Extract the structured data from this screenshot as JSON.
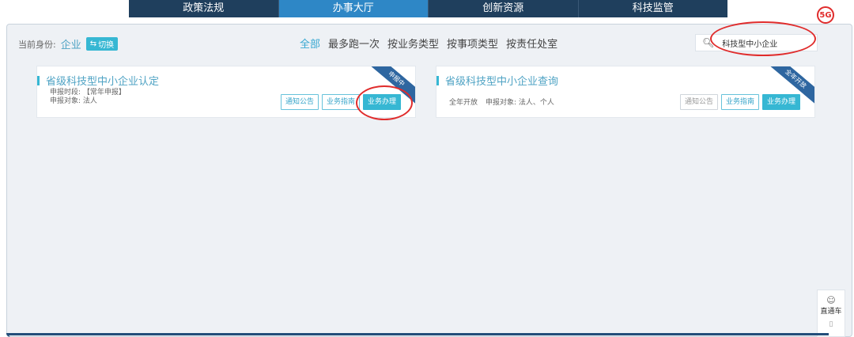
{
  "nav": {
    "tabs": [
      "政策法规",
      "办事大厅",
      "创新资源",
      "科技监管"
    ]
  },
  "identity": {
    "label": "当前身份:",
    "entity": "企业",
    "switch_label": "切换"
  },
  "filters": [
    "全部",
    "最多跑一次",
    "按业务类型",
    "按事项类型",
    "按责任处室"
  ],
  "search": {
    "value": "科技型中小企业"
  },
  "user_logo": "5G",
  "cards": [
    {
      "title": "省级科技型中小企业认定",
      "ribbon": "申报中",
      "time": "申报时段: 【常年申报】",
      "target": "申报对象: 法人",
      "buttons": [
        "通知公告",
        "业务指南",
        "业务办理"
      ]
    },
    {
      "title": "省级科技型中小企业查询",
      "ribbon": "全年开放",
      "open": "全年开放",
      "target": "申报对象: 法人、个人",
      "buttons": [
        "通知公告",
        "业务指南",
        "业务办理"
      ]
    }
  ],
  "side": {
    "label": "直通车"
  },
  "colors": {
    "accent": "#36b7d3",
    "nav_bg": "#1f3f5d",
    "nav_active": "#2e87c6",
    "ribbon": "#2e66a0",
    "annotation": "#e02c2c"
  }
}
